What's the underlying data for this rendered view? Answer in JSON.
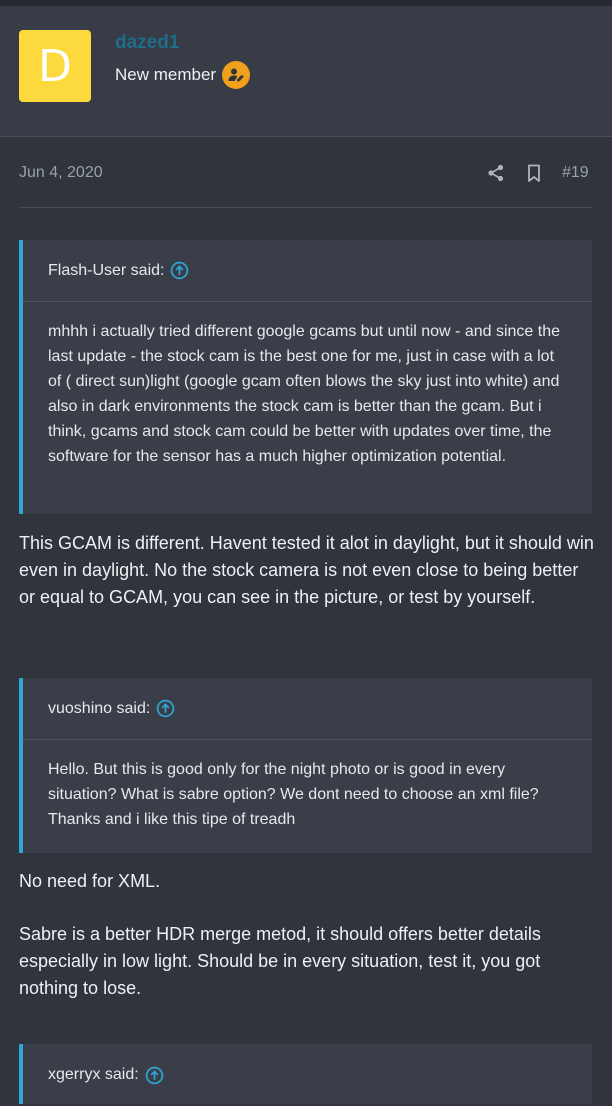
{
  "user": {
    "avatar_letter": "D",
    "avatar_color": "#fcd93c",
    "name": "dazed1",
    "name_color": "#1f6d8a",
    "title": "New member",
    "badge_icon": "user-edit-icon"
  },
  "post": {
    "date": "Jun 4, 2020",
    "number": "#19",
    "actions": [
      "share-icon",
      "bookmark-icon"
    ]
  },
  "quotes": [
    {
      "author": "Flash-User said:",
      "text": "mhhh i actually tried different google gcams but until now - and since the last update - the stock cam is the best one for me, just in case with a lot of ( direct sun)light (google gcam often blows the sky just into white) and also in dark environments the stock cam is better than the gcam. But i think, gcams and stock cam could be better with updates over time, the software for the sensor has a much higher optimization potential."
    },
    {
      "author": "vuoshino said:",
      "text": "Hello. But this is good only for the night photo or is good in every situation? What is sabre option? We dont need to choose an xml file? Thanks and i like this tipe of treadh"
    },
    {
      "author": "xgerryx said:"
    }
  ],
  "replies": {
    "reply1": "This GCAM is different. Havent tested it alot in daylight, but it should win even in daylight. No the stock camera is not even close to being better or equal to GCAM, you can see in the picture, or test by yourself.",
    "reply2a": "No need for XML.",
    "reply2b": "Sabre is a better HDR merge metod, it should offers better details especially in low light. Should be in every situation, test it, you got nothing to lose."
  },
  "colors": {
    "quote_accent": "#2fa7d6",
    "badge": "#f1a01d"
  }
}
